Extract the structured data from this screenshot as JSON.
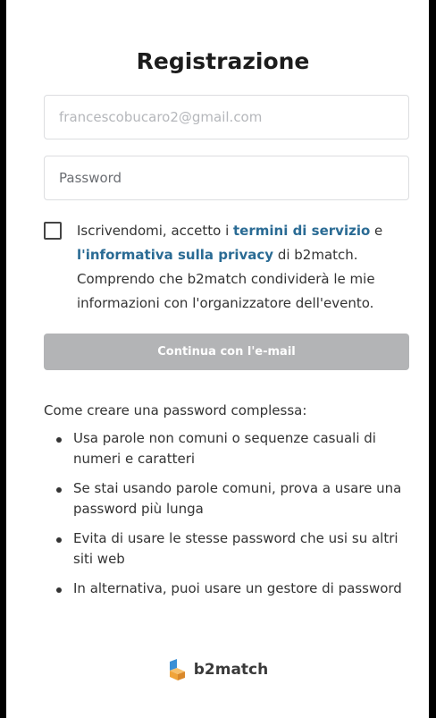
{
  "form": {
    "title": "Registrazione",
    "email_placeholder": "francescobucaro2@gmail.com",
    "password_placeholder": "Password",
    "consent": {
      "prefix": "Iscrivendomi, accetto i ",
      "terms_link": "termini di servizio",
      "middle": " e ",
      "privacy_link": "l'informativa sulla privacy",
      "suffix": " di b2match. Comprendo che b2match condividerà le mie informazioni con l'organizzatore dell'evento.",
      "checked": false
    },
    "submit_label": "Continua con l'e-mail"
  },
  "tips": {
    "heading": "Come creare una password complessa:",
    "items": [
      "Usa parole non comuni o sequenze casuali di numeri e caratteri",
      "Se stai usando parole comuni, prova a usare una password più lunga",
      "Evita di usare le stesse password che usi su altri siti web",
      "In alternativa, puoi usare un gestore di password"
    ]
  },
  "brand": {
    "name": "b2match",
    "logo_icon": "b2match-logo-icon"
  },
  "colors": {
    "link": "#2a6b94",
    "button_disabled": "#b3b4b6",
    "logo_blue": "#3a8fd6",
    "logo_orange": "#f0a43a"
  }
}
